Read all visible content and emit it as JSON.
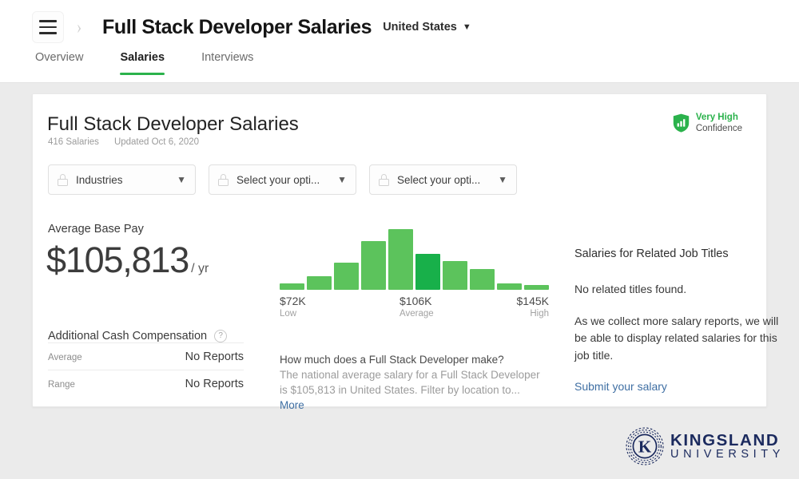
{
  "header": {
    "menu_icon": "hamburger-icon",
    "breadcrumb_chevron": "chevron-right-icon",
    "title": "Full Stack Developer Salaries",
    "location": "United States",
    "location_caret": "⌄",
    "tabs": [
      {
        "label": "Overview",
        "active": false
      },
      {
        "label": "Salaries",
        "active": true
      },
      {
        "label": "Interviews",
        "active": false
      }
    ]
  },
  "card": {
    "title": "Full Stack Developer Salaries",
    "salary_count": "416 Salaries",
    "updated": "Updated Oct 6, 2020",
    "confidence": {
      "icon": "shield-bars-icon",
      "level": "Very High",
      "label": "Confidence",
      "color": "#2bb24c"
    },
    "filters": [
      {
        "icon": "lock-icon",
        "label": "Industries",
        "caret": "⌄"
      },
      {
        "icon": "lock-icon",
        "label": "Select your opti...",
        "caret": "⌄"
      },
      {
        "icon": "lock-icon",
        "label": "Select your opti...",
        "caret": "⌄"
      }
    ],
    "pay": {
      "label": "Average Base Pay",
      "amount": "$105,813",
      "unit": "/ yr"
    },
    "additional": {
      "title": "Additional Cash Compensation",
      "help_icon": "question-icon",
      "rows": [
        {
          "key": "Average",
          "value": "No Reports"
        },
        {
          "key": "Range",
          "value": "No Reports"
        }
      ]
    },
    "blurb": {
      "question": "How much does a Full Stack Developer make?",
      "body": "The national average salary for a Full Stack Developer is $105,813 in United States. Filter by location to...",
      "more": "More"
    },
    "related": {
      "title": "Salaries for Related Job Titles",
      "empty": "No related titles found.",
      "body": "As we collect more salary reports, we will be able to display related salaries for this job title.",
      "link": "Submit your salary"
    }
  },
  "chart_data": {
    "type": "bar",
    "title": "Full Stack Developer salary distribution",
    "xlabel": "",
    "ylabel": "",
    "grid": false,
    "legend": null,
    "bar_color": "#5cc35c",
    "highlight_color": "#18b04a",
    "highlight_index": 5,
    "categories": [
      "1",
      "2",
      "3",
      "4",
      "5",
      "6",
      "7",
      "8",
      "9",
      "10"
    ],
    "values": [
      6,
      13,
      26,
      47,
      59,
      35,
      28,
      20,
      6,
      5
    ],
    "ylim": [
      0,
      62
    ],
    "axis_markers": [
      {
        "value": "$72K",
        "label": "Low",
        "position": "low"
      },
      {
        "value": "$106K",
        "label": "Average",
        "position": "average"
      },
      {
        "value": "$145K",
        "label": "High",
        "position": "high"
      }
    ]
  },
  "footer": {
    "logo_mark": "kingsland-k-logo-icon",
    "logo_line1": "KINGSLAND",
    "logo_line2": "UNIVERSITY",
    "logo_color": "#1b2a5e"
  }
}
